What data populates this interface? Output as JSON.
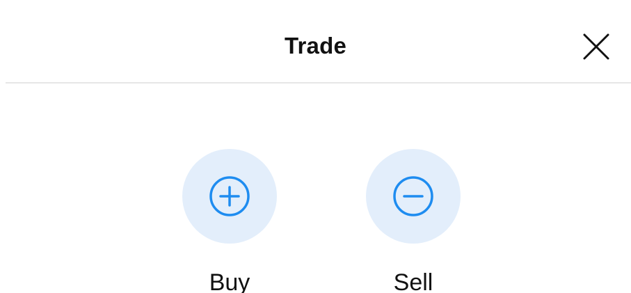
{
  "header": {
    "title": "Trade",
    "close_icon": "close-icon"
  },
  "actions": [
    {
      "label": "Buy",
      "icon": "plus-circle-icon"
    },
    {
      "label": "Sell",
      "icon": "minus-circle-icon"
    }
  ],
  "colors": {
    "accent": "#1e8cf0",
    "icon_background": "#e3eefb",
    "divider": "#e6e6e6",
    "text": "#111111"
  }
}
